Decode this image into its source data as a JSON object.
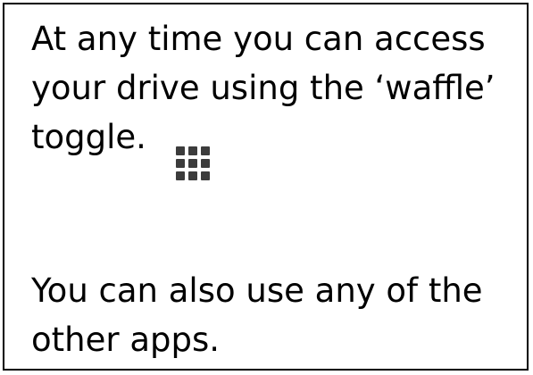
{
  "slide": {
    "para1_line1": "At any time you can access",
    "para1_line2": "your drive using the ‘waffle’",
    "para1_line3": "toggle.",
    "waffle_icon": "apps-grid-icon",
    "para2_line1": "You can also use any of the",
    "para2_line2": "other apps."
  },
  "colors": {
    "text": "#000000",
    "border": "#000000",
    "icon": "#3c3c3c"
  }
}
